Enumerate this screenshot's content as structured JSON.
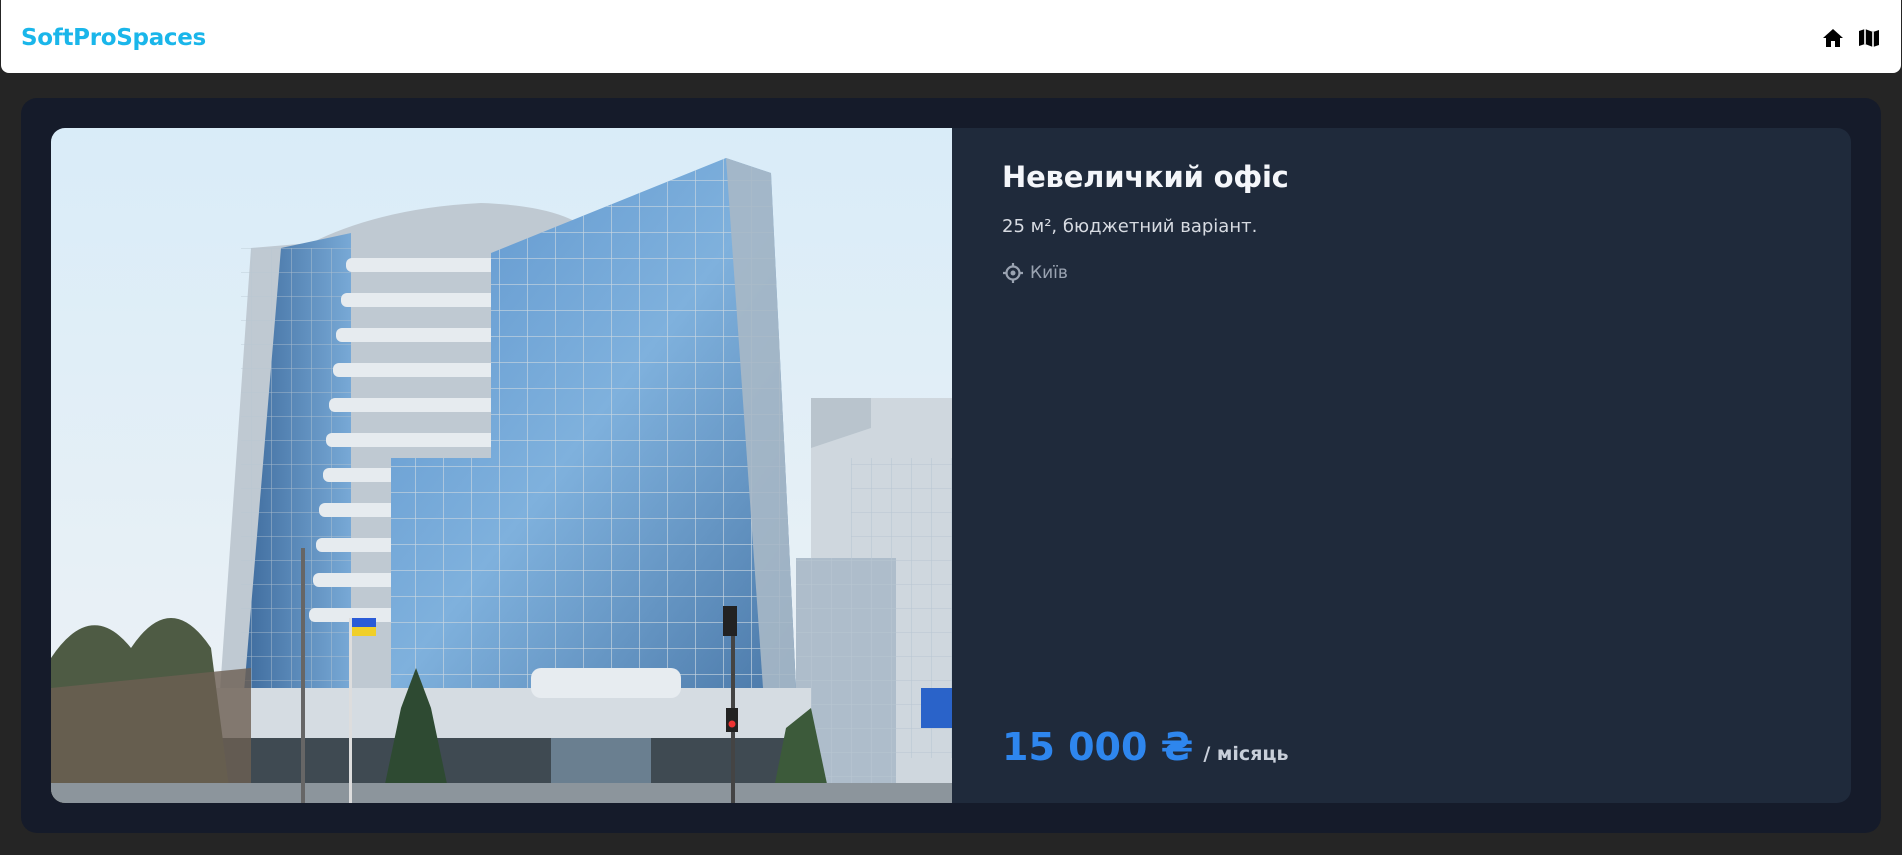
{
  "header": {
    "brand": "SoftProSpaces",
    "icons": [
      "home-icon",
      "map-icon"
    ]
  },
  "listing": {
    "title": "Невеличкий офіс",
    "description": "25 м², бюджетний варіант.",
    "location": "Київ",
    "location_icon": "location-target-icon",
    "price": "15 000 ₴",
    "period": "/ місяць"
  },
  "colors": {
    "brand": "#1ab6ea",
    "price": "#2e86ee",
    "card_bg": "#1f2a3b",
    "panel_bg": "#151b2a",
    "page_bg": "#252525"
  }
}
